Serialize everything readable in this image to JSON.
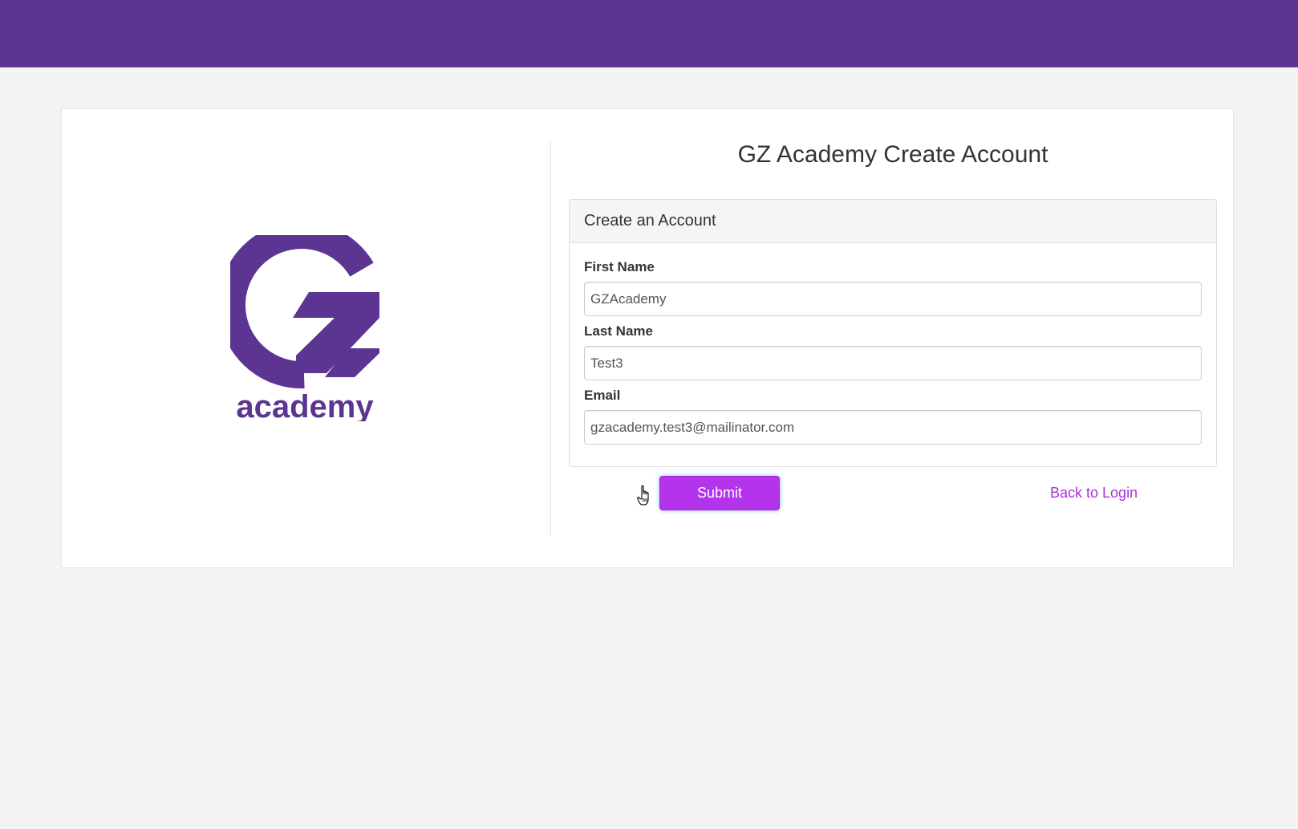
{
  "header": {
    "bar_color": "#5c3593"
  },
  "brand": {
    "logo_icon": "gz-academy-logo",
    "logo_text": "academy",
    "color": "#5c3593"
  },
  "page": {
    "title": "GZ Academy Create Account"
  },
  "form": {
    "heading": "Create an Account",
    "first_name": {
      "label": "First Name",
      "value": "GZAcademy"
    },
    "last_name": {
      "label": "Last Name",
      "value": "Test3"
    },
    "email": {
      "label": "Email",
      "value": "gzacademy.test3@mailinator.com"
    },
    "submit_label": "Submit",
    "back_link": "Back to Login",
    "accent_color": "#b434ec"
  }
}
